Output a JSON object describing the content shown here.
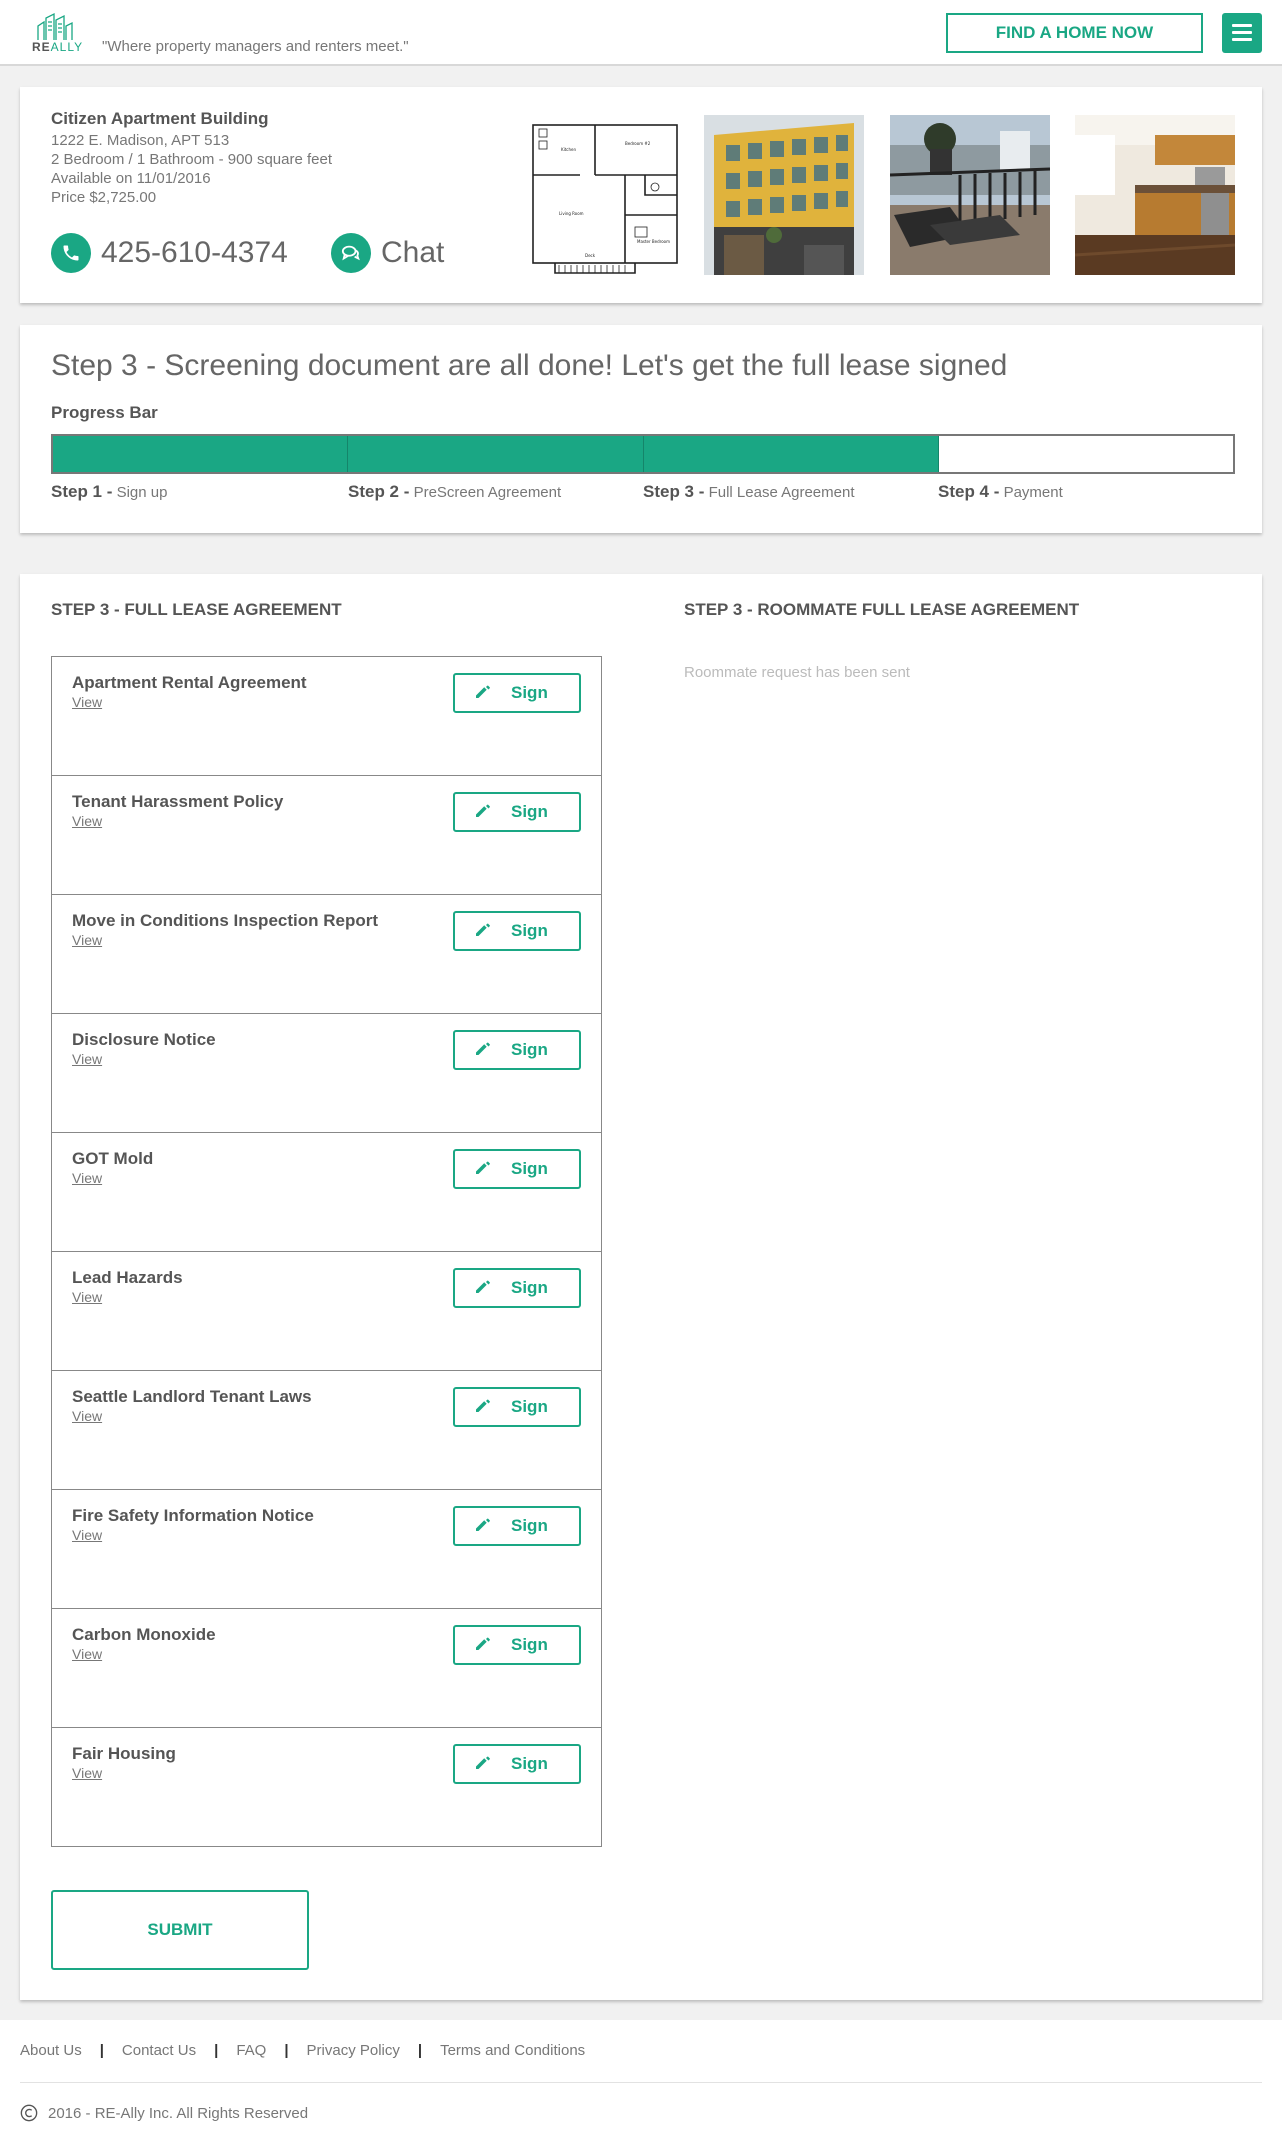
{
  "colors": {
    "accent": "#1aa784",
    "text": "#555555",
    "muted": "#777777",
    "background": "#f1f1f1"
  },
  "header": {
    "logo_text_bold": "RE",
    "logo_text_light": "ALLY",
    "tagline": "\"Where property managers and renters meet.\"",
    "find_home_label": "FIND A HOME NOW",
    "menu_icon": "hamburger-icon"
  },
  "listing": {
    "name": "Citizen Apartment Building",
    "address": "1222 E. Madison, APT 513",
    "details": "2 Bedroom / 1 Bathroom - 900 square feet",
    "available": "Available on 11/01/2016",
    "price": "Price $2,725.00",
    "phone": "425-610-4374",
    "chat_label": "Chat",
    "floorplan_labels": {
      "kitchen": "Kitchen",
      "bedroom2": "Bedroom #2",
      "living": "Living Room",
      "master": "Master Bedroom",
      "deck": "Deck"
    }
  },
  "progress": {
    "heading": "Step 3 - Screening document are all done! Let's get the full lease signed",
    "bar_label": "Progress Bar",
    "completed_steps": 3,
    "total_steps": 4,
    "steps": [
      {
        "num": "Step 1 -",
        "name": "Sign up"
      },
      {
        "num": "Step 2 -",
        "name": "PreScreen Agreement"
      },
      {
        "num": "Step 3 -",
        "name": "Full Lease Agreement"
      },
      {
        "num": "Step 4 -",
        "name": "Payment"
      }
    ]
  },
  "documents": {
    "left_title": "STEP 3 - FULL LEASE AGREEMENT",
    "right_title": "STEP 3 - ROOMMATE FULL LEASE AGREEMENT",
    "roommate_note": "Roommate request has been sent",
    "view_label": "View",
    "sign_label": "Sign",
    "items": [
      "Apartment Rental Agreement",
      "Tenant Harassment Policy",
      "Move in Conditions Inspection Report",
      "Disclosure Notice",
      "GOT Mold",
      "Lead Hazards",
      "Seattle Landlord Tenant Laws",
      "Fire Safety Information Notice",
      "Carbon Monoxide",
      "Fair Housing"
    ],
    "submit_label": "SUBMIT"
  },
  "footer": {
    "links": [
      "About Us",
      "Contact Us",
      "FAQ",
      "Privacy Policy",
      "Terms and Conditions"
    ],
    "copyright": "2016 - RE-Ally Inc. All Rights Reserved"
  }
}
